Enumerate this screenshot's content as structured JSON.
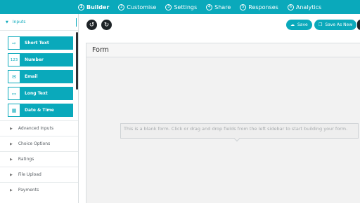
{
  "topnav": [
    {
      "num": "1",
      "label": "Builder",
      "active": true
    },
    {
      "num": "2",
      "label": "Customise"
    },
    {
      "num": "3",
      "label": "Settings"
    },
    {
      "num": "4",
      "label": "Share"
    },
    {
      "num": "5",
      "label": "Responses"
    },
    {
      "num": "6",
      "label": "Analytics"
    }
  ],
  "sidebar": {
    "section": "Inputs",
    "fields": [
      {
        "label": "Short Text",
        "icon": "arrow-right-icon"
      },
      {
        "label": "Number",
        "icon": "number-icon",
        "icon_text": "123"
      },
      {
        "label": "Email",
        "icon": "envelope-icon"
      },
      {
        "label": "Long Text",
        "icon": "text-area-icon"
      },
      {
        "label": "Date & Time",
        "icon": "calendar-icon"
      }
    ],
    "categories": [
      "Advanced Inputs",
      "Choice Options",
      "Ratings",
      "File Upload",
      "Payments"
    ]
  },
  "toolbar": {
    "save": "Save",
    "save_as_new": "Save As New"
  },
  "canvas": {
    "title": "Form",
    "hint": "This is a blank form. Click or drag and drop fields from the left sidebar to start building your form."
  },
  "colors": {
    "accent": "#0aa9bb",
    "dark": "#1e2327"
  }
}
